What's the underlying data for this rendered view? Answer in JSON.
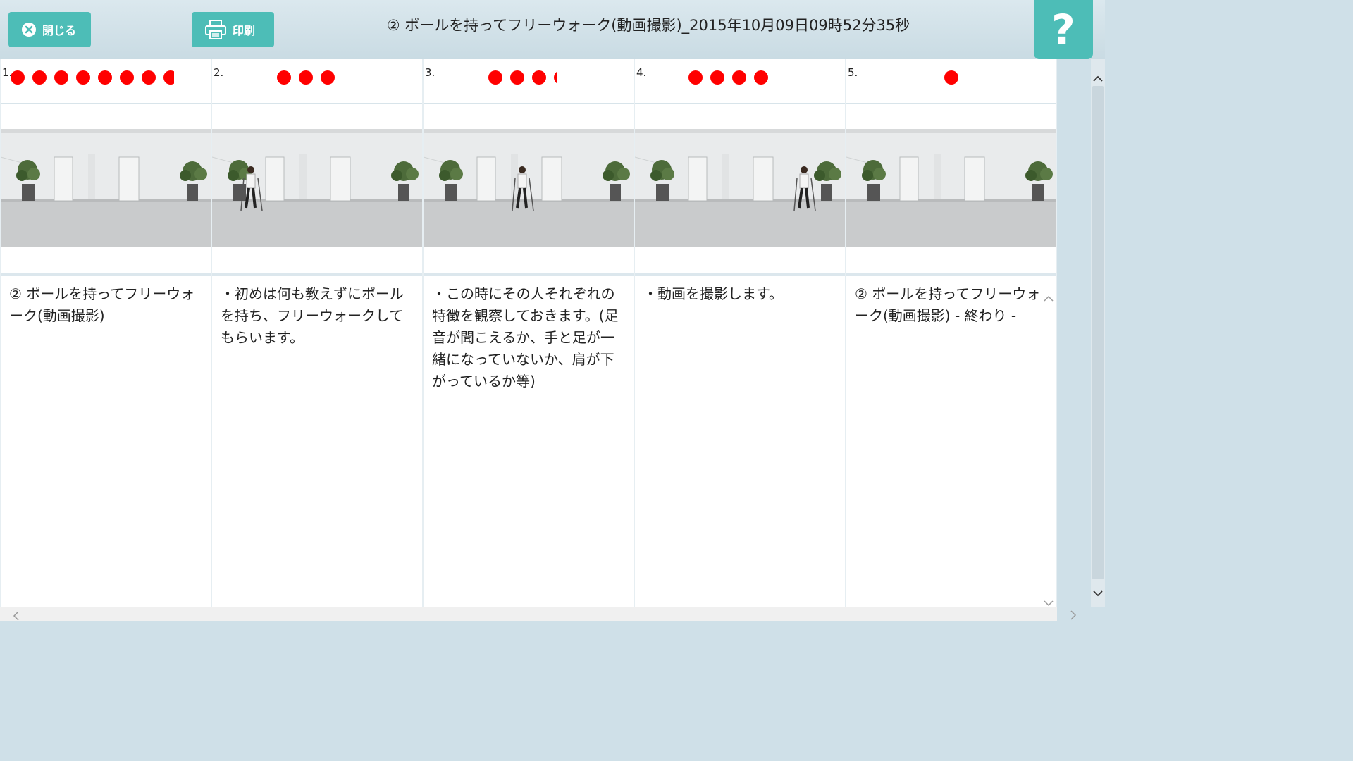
{
  "toolbar": {
    "close_label": "閉じる",
    "print_label": "印刷",
    "title": "② ポールを持ってフリーウォーク(動画撮影)_2015年10月09日09時52分35秒",
    "help_label": "?"
  },
  "steps": [
    {
      "number": "1.",
      "dot_count": 8,
      "text": "② ポールを持ってフリーウォーク(動画撮影)",
      "person": "none"
    },
    {
      "number": "2.",
      "dot_count": 3,
      "text": "・初めは何も教えずにポールを持ち、フリーウォークしてもらいます。",
      "person": "left"
    },
    {
      "number": "3.",
      "dot_count": 4,
      "text": "・この時にその人それぞれの特徴を観察しておきます。(足音が聞こえるか、手と足が一緒になっていないか、肩が下がっているか等)",
      "person": "center"
    },
    {
      "number": "4.",
      "dot_count": 4,
      "text": "・動画を撮影します。",
      "person": "right"
    },
    {
      "number": "5.",
      "dot_count": 1,
      "text": "② ポールを持ってフリーウォーク(動画撮影) - 終わり -",
      "person": "none"
    }
  ],
  "colors": {
    "accent": "#4dbdb7",
    "marker": "#ff0000",
    "background": "#cfe0e8"
  },
  "icons": [
    "close-circle-icon",
    "printer-icon",
    "question-mark-icon",
    "chevron-up-icon",
    "chevron-down-icon",
    "chevron-left-icon",
    "chevron-right-icon"
  ]
}
